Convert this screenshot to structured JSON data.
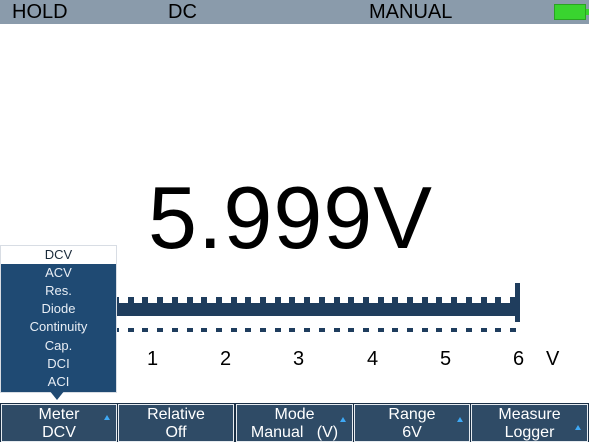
{
  "status_bar": {
    "hold": "HOLD",
    "coupling": "DC",
    "range_mode": "MANUAL",
    "battery_icon": "battery-full-icon",
    "battery_color": "#39d42f"
  },
  "reading": {
    "value": "5.999V"
  },
  "bargraph": {
    "scale_labels": [
      "1",
      "2",
      "3",
      "4",
      "5",
      "6",
      "V"
    ],
    "fill_fraction": 1.0,
    "bar_color": "#1f3d5d"
  },
  "meter_menu": {
    "items": [
      "DCV",
      "ACV",
      "Res.",
      "Diode",
      "Continuity",
      "Cap.",
      "DCI",
      "ACI"
    ],
    "selected": "DCV"
  },
  "softkeys": [
    {
      "top": "Meter",
      "bottom": "DCV",
      "has_arrow": true
    },
    {
      "top": "Relative",
      "bottom": "Off",
      "has_arrow": false
    },
    {
      "top": "Mode",
      "bottom": "Manual   (V)",
      "has_arrow": true
    },
    {
      "top": "Range",
      "bottom": "6V",
      "has_arrow": true
    },
    {
      "top": "Measure",
      "bottom": "Logger",
      "has_arrow": true
    }
  ],
  "colors": {
    "status_bar_bg": "#8a9bab",
    "softkey_bg": "#2f4b66",
    "menu_bg": "#1f4a73",
    "arrow_accent": "#3fa9f5"
  }
}
